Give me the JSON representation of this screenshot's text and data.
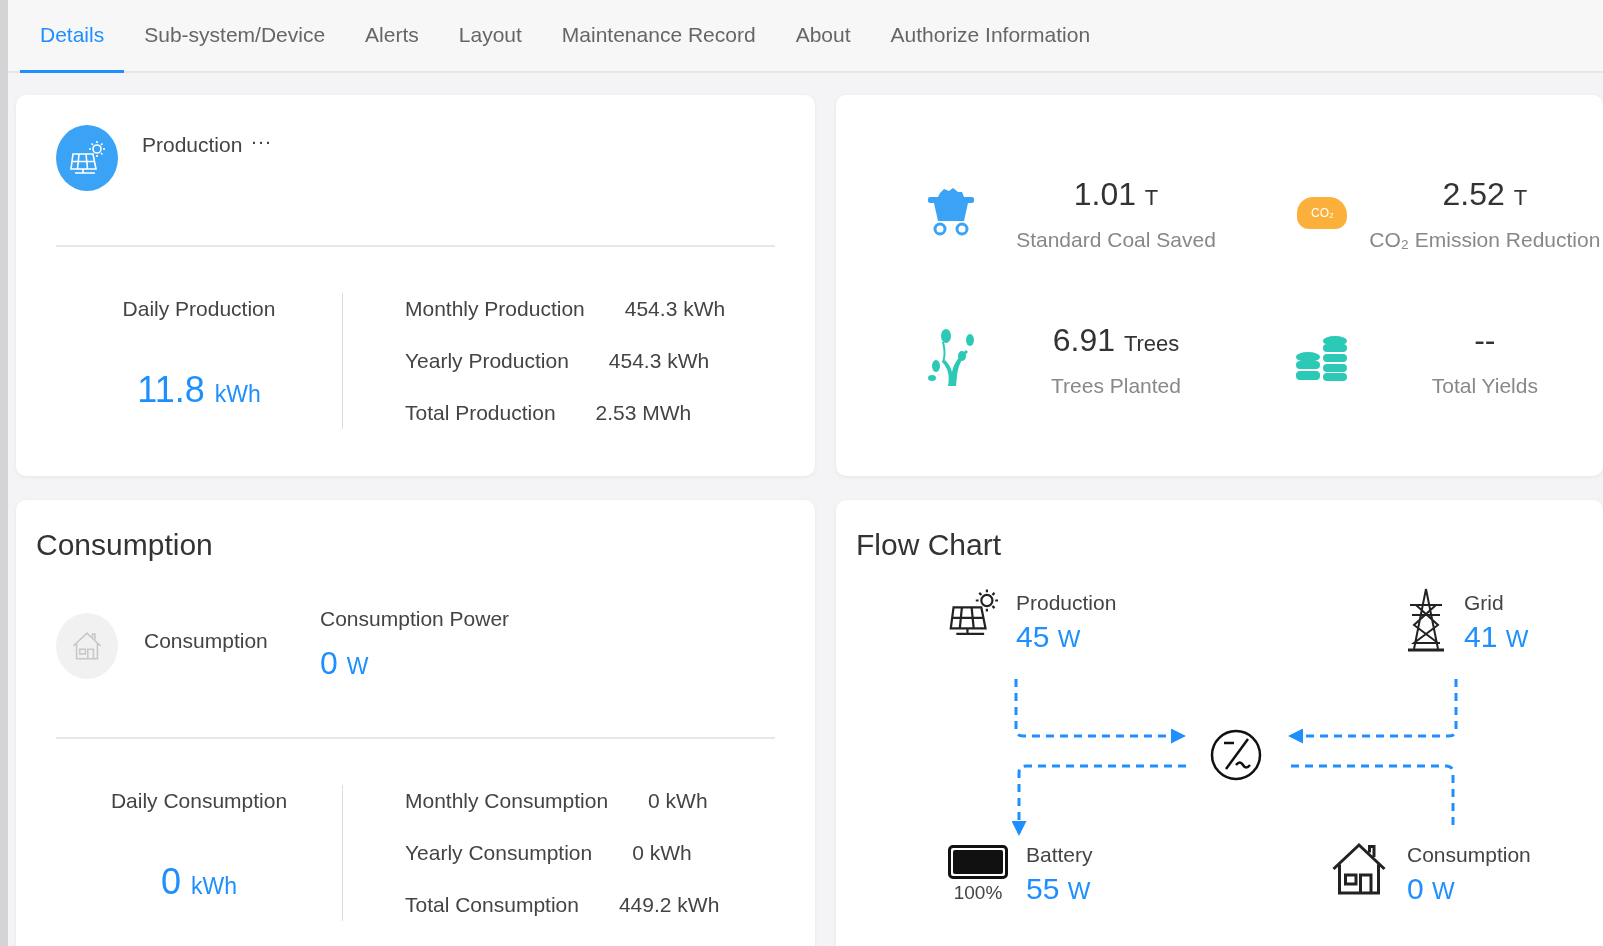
{
  "tabs": [
    {
      "label": "Details",
      "selected": true
    },
    {
      "label": "Sub-system/Device",
      "selected": false
    },
    {
      "label": "Alerts",
      "selected": false
    },
    {
      "label": "Layout",
      "selected": false
    },
    {
      "label": "Maintenance Record",
      "selected": false
    },
    {
      "label": "About",
      "selected": false
    },
    {
      "label": "Authorize Information",
      "selected": false
    }
  ],
  "production": {
    "title": "Production",
    "more": "···",
    "daily": {
      "label": "Daily Production",
      "value": "11.8",
      "unit": "kWh"
    },
    "rows": [
      {
        "label": "Monthly Production",
        "value": "454.3 kWh"
      },
      {
        "label": "Yearly Production",
        "value": "454.3 kWh"
      },
      {
        "label": "Total Production",
        "value": "2.53 MWh"
      }
    ]
  },
  "environment": [
    {
      "kind": "coal",
      "value": "1.01",
      "unit": "T",
      "label": "Standard Coal Saved"
    },
    {
      "kind": "co2",
      "badge": "CO₂",
      "value": "2.52",
      "unit": "T",
      "label": "CO₂ Emission Reduction"
    },
    {
      "kind": "tree",
      "value": "6.91",
      "unit": "Trees",
      "label": "Trees Planted"
    },
    {
      "kind": "coins",
      "value": "--",
      "label": "Total Yields"
    }
  ],
  "consumption": {
    "title": "Consumption",
    "name": "Consumption",
    "power": {
      "label": "Consumption Power",
      "value": "0",
      "unit": "W"
    },
    "daily": {
      "label": "Daily Consumption",
      "value": "0",
      "unit": "kWh"
    },
    "rows": [
      {
        "label": "Monthly Consumption",
        "value": "0 kWh"
      },
      {
        "label": "Yearly Consumption",
        "value": "0 kWh"
      },
      {
        "label": "Total Consumption",
        "value": "449.2 kWh"
      }
    ]
  },
  "flow_chart": {
    "title": "Flow Chart",
    "nodes": [
      {
        "kind": "production",
        "label": "Production",
        "value": "45",
        "unit": "W"
      },
      {
        "kind": "grid",
        "label": "Grid",
        "value": "41",
        "unit": "W"
      },
      {
        "kind": "battery",
        "label": "Battery",
        "value": "55",
        "unit": "W",
        "level": 1,
        "percent": "100%"
      },
      {
        "kind": "consumption",
        "label": "Consumption",
        "value": "0",
        "unit": "W"
      }
    ]
  }
}
